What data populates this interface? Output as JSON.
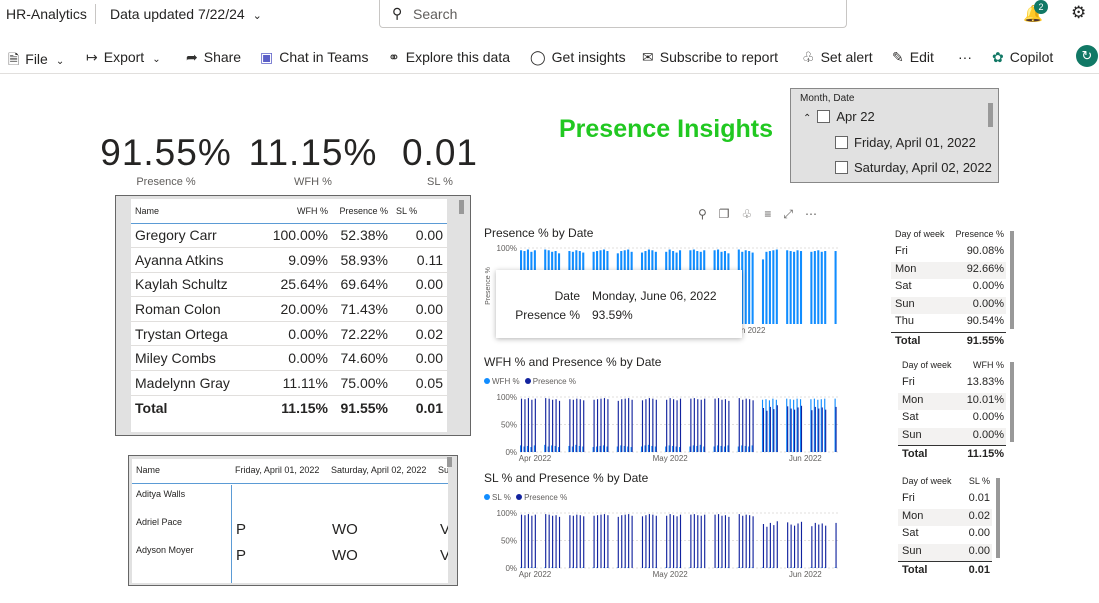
{
  "app": {
    "title": "HR-Analytics",
    "updated": "Data updated 7/22/24",
    "search_placeholder": "Search",
    "notification_count": "2"
  },
  "toolbar": {
    "file": "File",
    "export": "Export",
    "share": "Share",
    "chat": "Chat in Teams",
    "explore": "Explore this data",
    "insights": "Get insights",
    "subscribe": "Subscribe to report",
    "alert": "Set alert",
    "edit": "Edit",
    "more": "···",
    "copilot": "Copilot"
  },
  "kpis": [
    {
      "value": "91.55%",
      "label": "Presence %"
    },
    {
      "value": "11.15%",
      "label": "WFH %"
    },
    {
      "value": "0.01",
      "label": "SL %"
    }
  ],
  "page_title": "Presence Insights",
  "slicer": {
    "header": "Month, Date",
    "month": "Apr 22",
    "dates": [
      "Friday, April 01, 2022",
      "Saturday, April 02, 2022"
    ]
  },
  "employee_table": {
    "columns": [
      "Name",
      "WFH %",
      "Presence %",
      "SL %"
    ],
    "rows": [
      [
        "Gregory Carr",
        "100.00%",
        "52.38%",
        "0.00"
      ],
      [
        "Ayanna Atkins",
        "9.09%",
        "58.93%",
        "0.11"
      ],
      [
        "Kaylah Schultz",
        "25.64%",
        "69.64%",
        "0.00"
      ],
      [
        "Roman Colon",
        "20.00%",
        "71.43%",
        "0.00"
      ],
      [
        "Trystan Ortega",
        "0.00%",
        "72.22%",
        "0.02"
      ],
      [
        "Miley Combs",
        "0.00%",
        "74.60%",
        "0.00"
      ],
      [
        "Madelynn Gray",
        "11.11%",
        "75.00%",
        "0.05"
      ]
    ],
    "total": [
      "Total",
      "11.15%",
      "91.55%",
      "0.01"
    ]
  },
  "matrix": {
    "columns": [
      "Name",
      "Friday, April 01, 2022",
      "Saturday, April 02, 2022",
      "Su"
    ],
    "rows": [
      {
        "name": "Aditya Walls",
        "values": [
          "",
          "",
          ""
        ]
      },
      {
        "name": "Adriel Pace",
        "values": [
          "P",
          "WO",
          "V"
        ]
      },
      {
        "name": "Adyson Moyer",
        "values": [
          "P",
          "WO",
          "V"
        ]
      }
    ]
  },
  "tooltip": {
    "date_label": "Date",
    "date_value": "Monday, June 06, 2022",
    "presence_label": "Presence %",
    "presence_value": "93.59%"
  },
  "chart_data": [
    {
      "type": "bar",
      "title": "Presence % by Date",
      "ylabel": "Presence %",
      "ylim": [
        0,
        1
      ],
      "y_ticks": [
        "100%"
      ],
      "x_ticks": [
        "Jun 2022"
      ],
      "colors": {
        "presence": "#118dff"
      },
      "series": [
        {
          "name": "Presence %",
          "values": [
            0.97,
            0.96,
            0.98,
            0.95,
            0.97,
            0.94,
            0.96,
            0.98,
            0.97,
            0.95,
            0.96,
            0.93,
            0.97,
            0.98,
            0.96,
            0.95,
            0.97,
            0.96,
            0.94,
            0.98,
            0.97,
            0.95,
            0.96,
            0.97,
            0.98,
            0.96,
            0.95,
            0.97,
            0.93,
            0.96,
            0.97,
            0.98,
            0.95,
            0.96,
            0.97,
            0.94,
            0.96,
            0.98,
            0.97,
            0.95,
            0.96,
            0.97,
            0.95,
            0.98,
            0.96,
            0.94,
            0.97,
            0.96,
            0.95,
            0.97,
            0.98,
            0.96,
            0.95,
            0.97,
            0.96,
            0.94,
            0.97,
            0.98,
            0.95,
            0.96,
            0.93,
            0.97,
            0.96,
            0.98,
            0.95,
            0.97,
            0.96,
            0.94,
            0.97,
            0.98,
            0.85,
            0.95,
            0.96,
            0.97,
            0.98,
            0.96,
            0.95,
            0.97,
            0.96,
            0.95,
            0.97,
            0.96,
            0.98,
            0.97,
            0.95,
            0.96,
            0.97,
            0.95,
            0.96,
            0.97,
            0.98,
            0.96
          ]
        }
      ]
    },
    {
      "type": "bar",
      "title": "WFH % and Presence % by Date",
      "ylim": [
        0,
        1
      ],
      "y_ticks": [
        "100%",
        "50%",
        "0%"
      ],
      "x_ticks": [
        "Apr 2022",
        "May 2022",
        "Jun 2022"
      ],
      "colors": {
        "wfh": "#118dff",
        "presence": "#12239e"
      },
      "series": [
        {
          "name": "WFH %",
          "values": [
            0.12,
            0.1,
            0.11,
            0.09,
            0.12,
            0.1,
            0.11,
            0.13,
            0.1,
            0.12,
            0.11,
            0.09,
            0.1,
            0.12,
            0.11,
            0.1,
            0.13,
            0.11,
            0.1,
            0.12,
            0.11,
            0.09,
            0.1,
            0.11,
            0.12,
            0.1,
            0.13,
            0.11,
            0.1,
            0.12,
            0.11,
            0.1,
            0.09,
            0.12,
            0.11,
            0.1,
            0.12,
            0.13,
            0.11,
            0.1,
            0.12,
            0.11,
            0.1,
            0.12,
            0.11,
            0.1,
            0.09,
            0.12,
            0.11,
            0.1,
            0.12,
            0.11,
            0.13,
            0.1,
            0.12,
            0.11,
            0.1,
            0.12,
            0.11,
            0.1,
            0.12,
            0.11,
            0.13,
            0.1,
            0.12,
            0.11,
            0.1,
            0.12,
            0.11,
            0.1,
            0.95,
            0.96,
            0.94,
            0.97,
            0.95,
            0.96,
            0.94,
            0.97,
            0.96,
            0.95,
            0.97,
            0.96,
            0.95,
            0.94,
            0.96,
            0.97,
            0.95,
            0.96,
            0.97,
            0.95,
            0.96,
            0.97
          ]
        },
        {
          "name": "Presence %",
          "values": [
            0.97,
            0.96,
            0.98,
            0.95,
            0.97,
            0.94,
            0.96,
            0.98,
            0.97,
            0.95,
            0.96,
            0.93,
            0.97,
            0.98,
            0.96,
            0.95,
            0.97,
            0.96,
            0.94,
            0.98,
            0.97,
            0.95,
            0.96,
            0.97,
            0.98,
            0.96,
            0.95,
            0.97,
            0.93,
            0.96,
            0.97,
            0.98,
            0.95,
            0.96,
            0.97,
            0.94,
            0.96,
            0.98,
            0.97,
            0.95,
            0.96,
            0.97,
            0.95,
            0.98,
            0.96,
            0.94,
            0.97,
            0.96,
            0.95,
            0.97,
            0.98,
            0.96,
            0.95,
            0.97,
            0.96,
            0.94,
            0.97,
            0.98,
            0.95,
            0.96,
            0.93,
            0.97,
            0.96,
            0.98,
            0.95,
            0.97,
            0.96,
            0.94,
            0.97,
            0.98,
            0.8,
            0.75,
            0.82,
            0.78,
            0.85,
            0.76,
            0.8,
            0.83,
            0.79,
            0.77,
            0.81,
            0.84,
            0.78,
            0.8,
            0.76,
            0.82,
            0.79,
            0.81,
            0.77,
            0.8,
            0.78,
            0.82
          ]
        }
      ]
    },
    {
      "type": "bar",
      "title": "SL % and Presence % by Date",
      "ylim": [
        0,
        1
      ],
      "y_ticks": [
        "100%",
        "50%",
        "0%"
      ],
      "x_ticks": [
        "Apr 2022",
        "May 2022",
        "Jun 2022"
      ],
      "colors": {
        "sl": "#118dff",
        "presence": "#12239e"
      },
      "series": [
        {
          "name": "SL %",
          "values": [
            0.01,
            0.01,
            0.0,
            0.01,
            0.01,
            0.0,
            0.01,
            0.01,
            0.0,
            0.01,
            0.01,
            0.0,
            0.01,
            0.01,
            0.0,
            0.01,
            0.01,
            0.0,
            0.01,
            0.01,
            0.0,
            0.01,
            0.01,
            0.0,
            0.01,
            0.01,
            0.0,
            0.01,
            0.01,
            0.0,
            0.01,
            0.01,
            0.0,
            0.01,
            0.01,
            0.0,
            0.01,
            0.01,
            0.0,
            0.01,
            0.01,
            0.0,
            0.01,
            0.01,
            0.0,
            0.01,
            0.01,
            0.0,
            0.01,
            0.01,
            0.0,
            0.01,
            0.01,
            0.0,
            0.01,
            0.01,
            0.0,
            0.01,
            0.01,
            0.0,
            0.01,
            0.01,
            0.0,
            0.01,
            0.01,
            0.0,
            0.01,
            0.01,
            0.0,
            0.01,
            0.01,
            0.0,
            0.01,
            0.01,
            0.0,
            0.01,
            0.01,
            0.0,
            0.01,
            0.01,
            0.0,
            0.01,
            0.01,
            0.0,
            0.01,
            0.01,
            0.0,
            0.01,
            0.01,
            0.0,
            0.01,
            0.01
          ]
        },
        {
          "name": "Presence %",
          "values": [
            0.97,
            0.96,
            0.98,
            0.95,
            0.97,
            0.94,
            0.96,
            0.98,
            0.97,
            0.95,
            0.96,
            0.93,
            0.97,
            0.98,
            0.96,
            0.95,
            0.97,
            0.96,
            0.94,
            0.98,
            0.97,
            0.95,
            0.96,
            0.97,
            0.98,
            0.96,
            0.95,
            0.97,
            0.93,
            0.96,
            0.97,
            0.98,
            0.95,
            0.96,
            0.97,
            0.94,
            0.96,
            0.98,
            0.97,
            0.95,
            0.96,
            0.97,
            0.95,
            0.98,
            0.96,
            0.94,
            0.97,
            0.96,
            0.95,
            0.97,
            0.98,
            0.96,
            0.95,
            0.97,
            0.96,
            0.94,
            0.97,
            0.98,
            0.95,
            0.96,
            0.93,
            0.97,
            0.96,
            0.98,
            0.95,
            0.97,
            0.96,
            0.94,
            0.97,
            0.98,
            0.8,
            0.75,
            0.82,
            0.78,
            0.85,
            0.76,
            0.8,
            0.83,
            0.79,
            0.77,
            0.81,
            0.84,
            0.78,
            0.8,
            0.76,
            0.82,
            0.79,
            0.81,
            0.77,
            0.8,
            0.78,
            0.82
          ]
        }
      ]
    }
  ],
  "dow_presence": {
    "headers": [
      "Day of week",
      "Presence %"
    ],
    "rows": [
      [
        "Fri",
        "90.08%"
      ],
      [
        "Mon",
        "92.66%"
      ],
      [
        "Sat",
        "0.00%"
      ],
      [
        "Sun",
        "0.00%"
      ],
      [
        "Thu",
        "90.54%"
      ]
    ],
    "total": [
      "Total",
      "91.55%"
    ]
  },
  "dow_wfh": {
    "headers": [
      "Day of week",
      "WFH %"
    ],
    "rows": [
      [
        "Fri",
        "13.83%"
      ],
      [
        "Mon",
        "10.01%"
      ],
      [
        "Sat",
        "0.00%"
      ],
      [
        "Sun",
        "0.00%"
      ]
    ],
    "total": [
      "Total",
      "11.15%"
    ]
  },
  "dow_sl": {
    "headers": [
      "Day of week",
      "SL %"
    ],
    "rows": [
      [
        "Fri",
        "0.01"
      ],
      [
        "Mon",
        "0.02"
      ],
      [
        "Sat",
        "0.00"
      ],
      [
        "Sun",
        "0.00"
      ]
    ],
    "total": [
      "Total",
      "0.01"
    ]
  }
}
